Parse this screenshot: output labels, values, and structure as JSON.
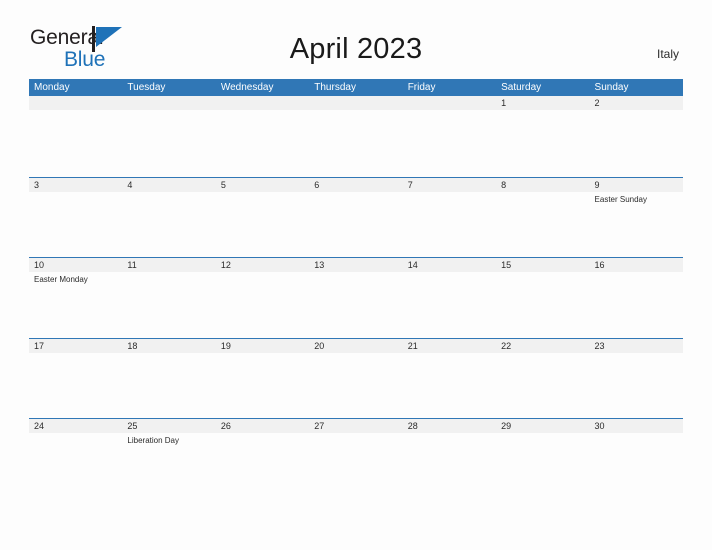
{
  "brand": {
    "word1": "General",
    "word2": "Blue",
    "flag_icon": "general-blue-flag-logo",
    "dark_color": "#231f20",
    "blue_color": "#1f72b8"
  },
  "header": {
    "title": "April 2023",
    "country": "Italy"
  },
  "theme": {
    "header_blue": "#3077b6",
    "date_bar_gray": "#f1f1f1",
    "page_background": "#fdfdfd",
    "text_color": "#2b2b2b"
  },
  "calendar": {
    "weekday_headers": [
      "Monday",
      "Tuesday",
      "Wednesday",
      "Thursday",
      "Friday",
      "Saturday",
      "Sunday"
    ],
    "weeks": [
      {
        "dates": [
          "",
          "",
          "",
          "",
          "",
          "1",
          "2"
        ],
        "events": [
          "",
          "",
          "",
          "",
          "",
          "",
          ""
        ]
      },
      {
        "dates": [
          "3",
          "4",
          "5",
          "6",
          "7",
          "8",
          "9"
        ],
        "events": [
          "",
          "",
          "",
          "",
          "",
          "",
          "Easter Sunday"
        ]
      },
      {
        "dates": [
          "10",
          "11",
          "12",
          "13",
          "14",
          "15",
          "16"
        ],
        "events": [
          "Easter Monday",
          "",
          "",
          "",
          "",
          "",
          ""
        ]
      },
      {
        "dates": [
          "17",
          "18",
          "19",
          "20",
          "21",
          "22",
          "23"
        ],
        "events": [
          "",
          "",
          "",
          "",
          "",
          "",
          ""
        ]
      },
      {
        "dates": [
          "24",
          "25",
          "26",
          "27",
          "28",
          "29",
          "30"
        ],
        "events": [
          "",
          "Liberation Day",
          "",
          "",
          "",
          "",
          ""
        ]
      }
    ]
  }
}
